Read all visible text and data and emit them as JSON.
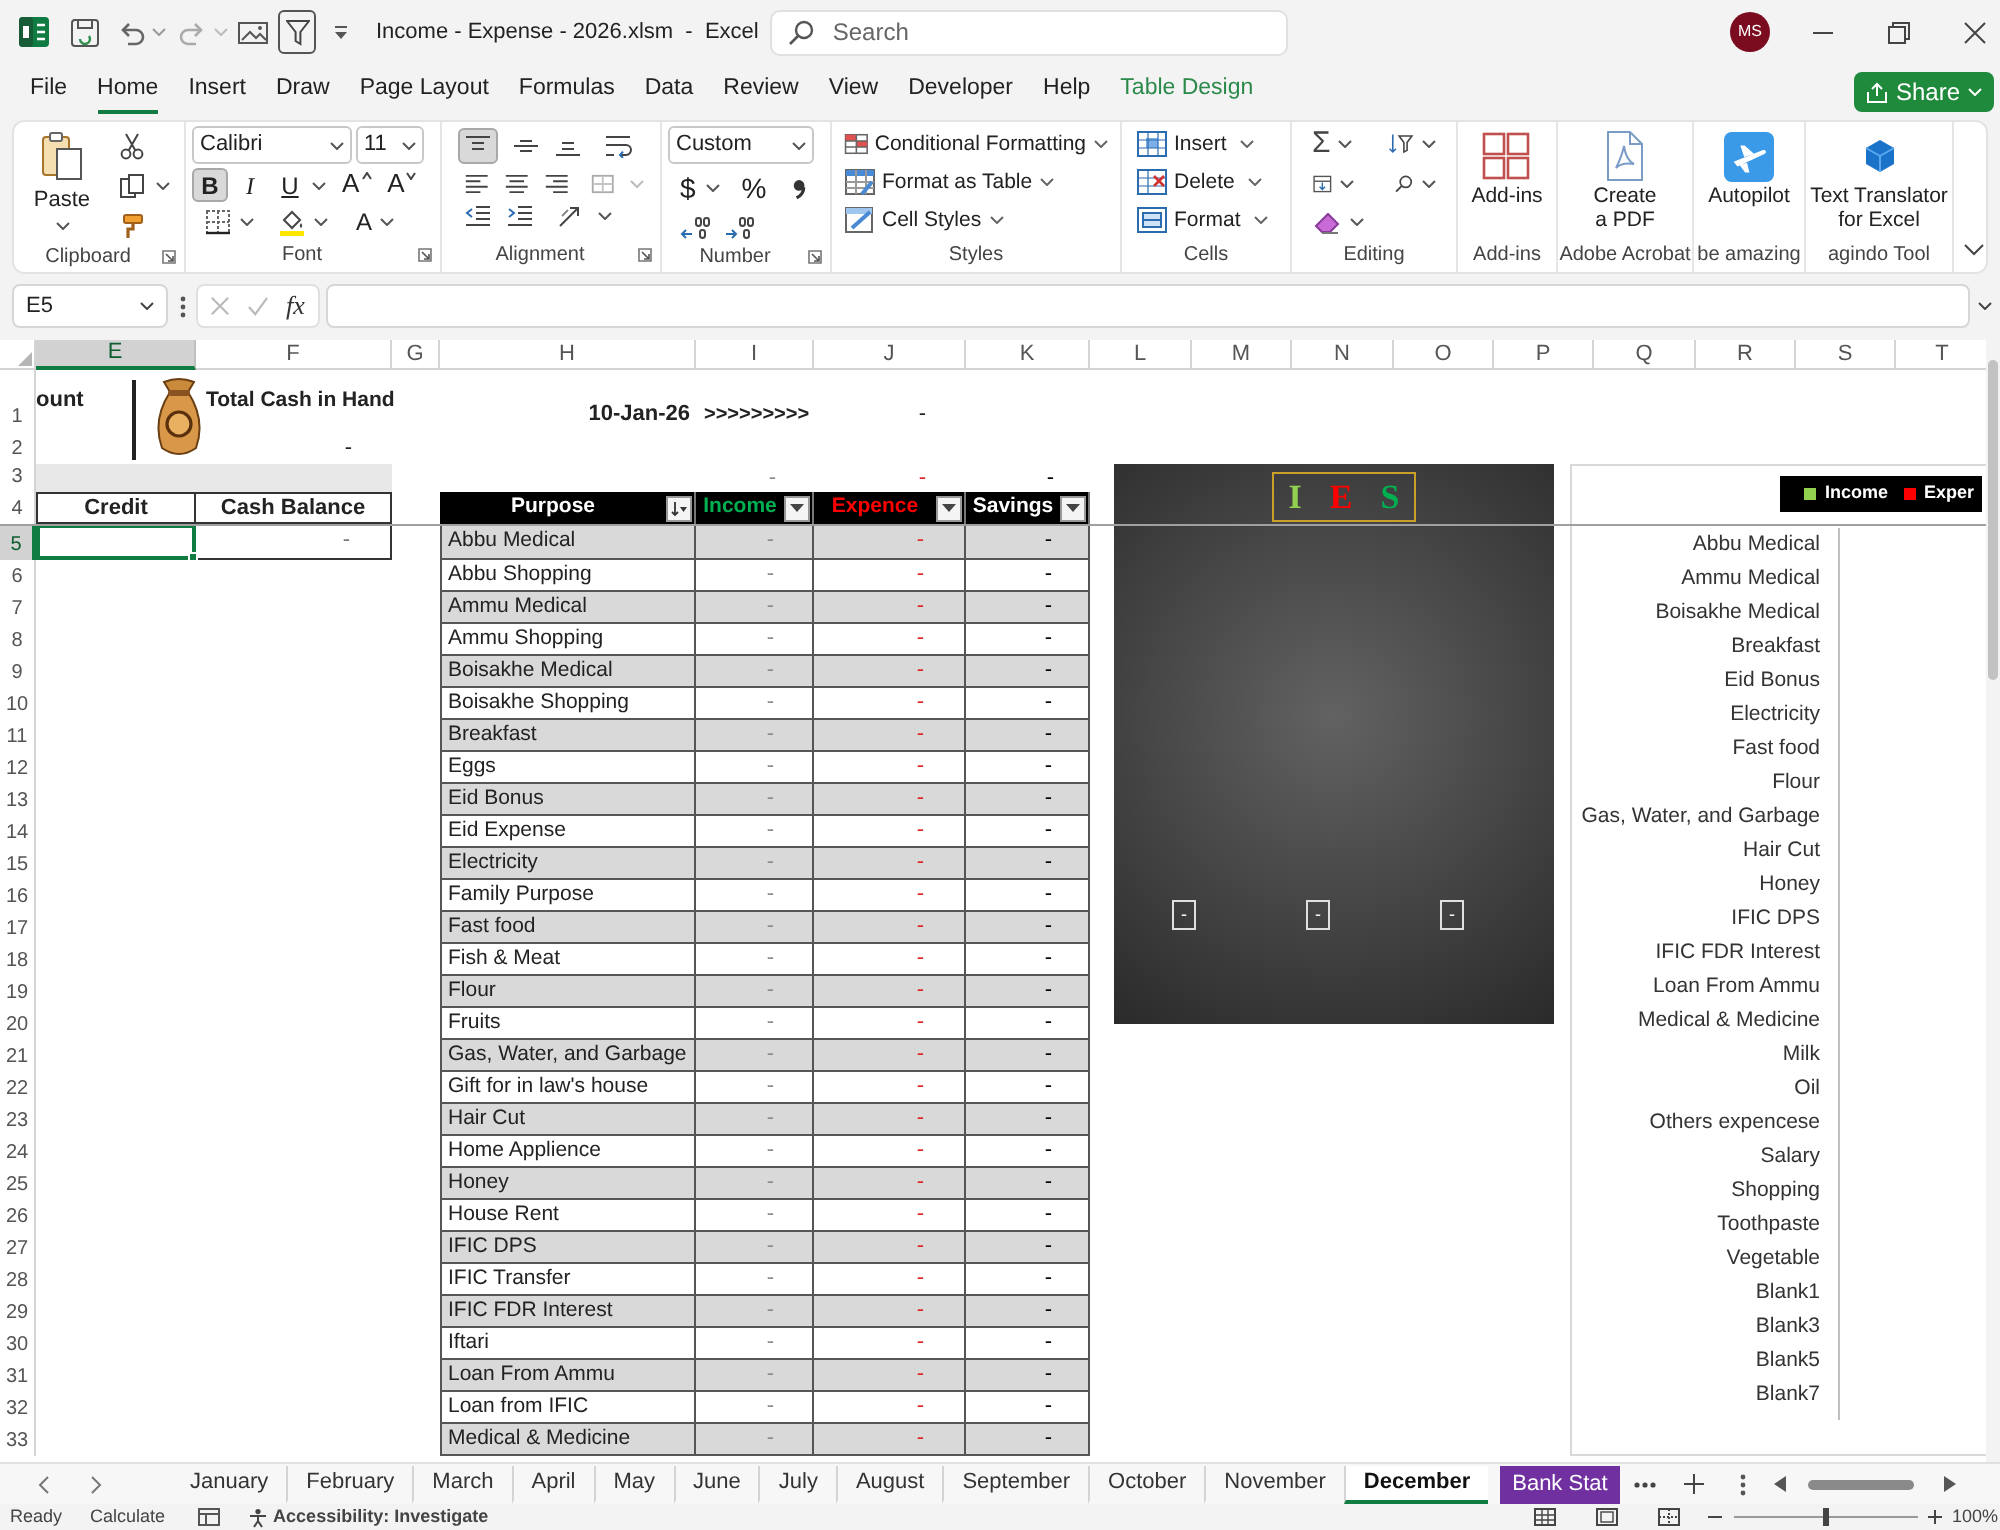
{
  "title_bar": {
    "title": "Income - Expense - 2026.xlsm  -  Excel",
    "search": {
      "placeholder": "Search"
    },
    "avatar": "MS"
  },
  "ribbon_tabs": [
    {
      "label": "File",
      "selected": false,
      "kind": "tab"
    },
    {
      "label": "Home",
      "selected": true,
      "kind": "tab"
    },
    {
      "label": "Insert",
      "selected": false,
      "kind": "tab"
    },
    {
      "label": "Draw",
      "selected": false,
      "kind": "tab"
    },
    {
      "label": "Page Layout",
      "selected": false,
      "kind": "tab"
    },
    {
      "label": "Formulas",
      "selected": false,
      "kind": "tab"
    },
    {
      "label": "Data",
      "selected": false,
      "kind": "tab"
    },
    {
      "label": "Review",
      "selected": false,
      "kind": "tab"
    },
    {
      "label": "View",
      "selected": false,
      "kind": "tab"
    },
    {
      "label": "Developer",
      "selected": false,
      "kind": "tab"
    },
    {
      "label": "Help",
      "selected": false,
      "kind": "tab"
    },
    {
      "label": "Table Design",
      "selected": false,
      "kind": "contextual"
    }
  ],
  "share": "Share",
  "ribbon_groups": [
    {
      "kind": "clipboard",
      "label": "Clipboard",
      "paste": "Paste"
    },
    {
      "kind": "font",
      "label": "Font",
      "font_name": "Calibri",
      "font_size": "11",
      "styles": [
        {
          "label": "B",
          "selected": true
        },
        {
          "label": "I",
          "selected": false
        },
        {
          "label": "U",
          "selected": false
        }
      ],
      "size_steps": [
        "A",
        "A"
      ],
      "font_color": "A"
    },
    {
      "kind": "alignment",
      "label": "Alignment",
      "top_align": true
    },
    {
      "kind": "number",
      "label": "Number",
      "format": "Custom",
      "currency": "$",
      "percent": "%"
    },
    {
      "kind": "styles",
      "label": "Styles",
      "commands": [
        "Conditional Formatting",
        "Format as Table",
        "Cell Styles"
      ]
    },
    {
      "kind": "cells",
      "label": "Cells",
      "commands": [
        "Insert",
        "Delete",
        "Format"
      ]
    },
    {
      "kind": "editing",
      "label": "Editing",
      "sum": "Σ"
    },
    {
      "kind": "addins",
      "label": "Add-ins",
      "button": [
        "Add-ins"
      ]
    },
    {
      "kind": "acrobat",
      "label": "Adobe Acrobat",
      "button": [
        "Create",
        "a PDF"
      ]
    },
    {
      "kind": "autopilot",
      "label": "be amazing",
      "button": [
        "Autopilot"
      ]
    },
    {
      "kind": "translator",
      "label": "agindo Tool",
      "button": [
        "Text Translator",
        "for Excel"
      ]
    }
  ],
  "formula_bar": {
    "name_box": "E5",
    "function_label": "fx"
  },
  "columns": [
    {
      "label": "E",
      "selected": true
    },
    {
      "label": "F",
      "selected": false
    },
    {
      "label": "G",
      "selected": false
    },
    {
      "label": "H",
      "selected": false
    },
    {
      "label": "I",
      "selected": false
    },
    {
      "label": "J",
      "selected": false
    },
    {
      "label": "K",
      "selected": false
    },
    {
      "label": "L",
      "selected": false
    },
    {
      "label": "M",
      "selected": false
    },
    {
      "label": "N",
      "selected": false
    },
    {
      "label": "O",
      "selected": false
    },
    {
      "label": "P",
      "selected": false
    },
    {
      "label": "Q",
      "selected": false
    },
    {
      "label": "R",
      "selected": false
    },
    {
      "label": "S",
      "selected": false
    },
    {
      "label": "T",
      "selected": false
    }
  ],
  "rows": [
    {
      "label": "1",
      "selected": false
    },
    {
      "label": "2",
      "selected": false
    },
    {
      "label": "3",
      "selected": false
    },
    {
      "label": "4",
      "selected": false
    },
    {
      "label": "5",
      "selected": true
    },
    {
      "label": "6",
      "selected": false
    },
    {
      "label": "7",
      "selected": false
    },
    {
      "label": "8",
      "selected": false
    },
    {
      "label": "9",
      "selected": false
    },
    {
      "label": "10",
      "selected": false
    },
    {
      "label": "11",
      "selected": false
    },
    {
      "label": "12",
      "selected": false
    },
    {
      "label": "13",
      "selected": false
    },
    {
      "label": "14",
      "selected": false
    },
    {
      "label": "15",
      "selected": false
    },
    {
      "label": "16",
      "selected": false
    },
    {
      "label": "17",
      "selected": false
    },
    {
      "label": "18",
      "selected": false
    },
    {
      "label": "19",
      "selected": false
    },
    {
      "label": "20",
      "selected": false
    },
    {
      "label": "21",
      "selected": false
    },
    {
      "label": "22",
      "selected": false
    },
    {
      "label": "23",
      "selected": false
    },
    {
      "label": "24",
      "selected": false
    },
    {
      "label": "25",
      "selected": false
    },
    {
      "label": "26",
      "selected": false
    },
    {
      "label": "27",
      "selected": false
    },
    {
      "label": "28",
      "selected": false
    },
    {
      "label": "29",
      "selected": false
    },
    {
      "label": "30",
      "selected": false
    },
    {
      "label": "31",
      "selected": false
    },
    {
      "label": "32",
      "selected": false
    },
    {
      "label": "33",
      "selected": false
    }
  ],
  "summary": {
    "amount_label": "ount",
    "cash_title": "Total Cash in Hand",
    "cash_value": "-",
    "date": "10-Jan-26",
    "arrows": ">>>>>>>>>",
    "date_value": "-",
    "totals": [
      "-",
      "-",
      "-"
    ]
  },
  "ledger": {
    "headers": [
      "Credit",
      "Cash Balance"
    ],
    "credit_selected": true,
    "balance": "-"
  },
  "table": {
    "columns": [
      {
        "label": "Purpose",
        "kind": "purpose",
        "sorted": true
      },
      {
        "label": "Income",
        "kind": "income",
        "sorted": false
      },
      {
        "label": "Expence",
        "kind": "expense",
        "sorted": false
      },
      {
        "label": "Savings",
        "kind": "savings",
        "sorted": false
      }
    ],
    "rows": [
      {
        "purpose": "Abbu Medical",
        "values": [
          "-",
          "-",
          "-"
        ]
      },
      {
        "purpose": "Abbu Shopping",
        "values": [
          "-",
          "-",
          "-"
        ]
      },
      {
        "purpose": "Ammu Medical",
        "values": [
          "-",
          "-",
          "-"
        ]
      },
      {
        "purpose": "Ammu Shopping",
        "values": [
          "-",
          "-",
          "-"
        ]
      },
      {
        "purpose": "Boisakhe Medical",
        "values": [
          "-",
          "-",
          "-"
        ]
      },
      {
        "purpose": "Boisakhe Shopping",
        "values": [
          "-",
          "-",
          "-"
        ]
      },
      {
        "purpose": "Breakfast",
        "values": [
          "-",
          "-",
          "-"
        ]
      },
      {
        "purpose": "Eggs",
        "values": [
          "-",
          "-",
          "-"
        ]
      },
      {
        "purpose": "Eid Bonus",
        "values": [
          "-",
          "-",
          "-"
        ]
      },
      {
        "purpose": "Eid Expense",
        "values": [
          "-",
          "-",
          "-"
        ]
      },
      {
        "purpose": "Electricity",
        "values": [
          "-",
          "-",
          "-"
        ]
      },
      {
        "purpose": "Family Purpose",
        "values": [
          "-",
          "-",
          "-"
        ]
      },
      {
        "purpose": "Fast food",
        "values": [
          "-",
          "-",
          "-"
        ]
      },
      {
        "purpose": "Fish & Meat",
        "values": [
          "-",
          "-",
          "-"
        ]
      },
      {
        "purpose": "Flour",
        "values": [
          "-",
          "-",
          "-"
        ]
      },
      {
        "purpose": "Fruits",
        "values": [
          "-",
          "-",
          "-"
        ]
      },
      {
        "purpose": "Gas, Water, and Garbage",
        "values": [
          "-",
          "-",
          "-"
        ]
      },
      {
        "purpose": "Gift for in law's house",
        "values": [
          "-",
          "-",
          "-"
        ]
      },
      {
        "purpose": "Hair Cut",
        "values": [
          "-",
          "-",
          "-"
        ]
      },
      {
        "purpose": "Home Applience",
        "values": [
          "-",
          "-",
          "-"
        ]
      },
      {
        "purpose": "Honey",
        "values": [
          "-",
          "-",
          "-"
        ]
      },
      {
        "purpose": "House Rent",
        "values": [
          "-",
          "-",
          "-"
        ]
      },
      {
        "purpose": "IFIC DPS",
        "values": [
          "-",
          "-",
          "-"
        ]
      },
      {
        "purpose": "IFIC Transfer",
        "values": [
          "-",
          "-",
          "-"
        ]
      },
      {
        "purpose": "IFIC FDR Interest",
        "values": [
          "-",
          "-",
          "-"
        ]
      },
      {
        "purpose": "Iftari",
        "values": [
          "-",
          "-",
          "-"
        ]
      },
      {
        "purpose": "Loan From Ammu",
        "values": [
          "-",
          "-",
          "-"
        ]
      },
      {
        "purpose": "Loan from IFIC",
        "values": [
          "-",
          "-",
          "-"
        ]
      },
      {
        "purpose": "Medical & Medicine",
        "values": [
          "-",
          "-",
          "-"
        ]
      }
    ]
  },
  "ies_chart": {
    "title_letters": [
      {
        "text": "I",
        "color": "#92d050"
      },
      {
        "text": "E",
        "color": "#ff0000"
      },
      {
        "text": "S",
        "color": "#00b050"
      }
    ],
    "bar_labels": [
      "-",
      "-",
      "-"
    ]
  },
  "category_chart": {
    "legend": [
      {
        "label": "Income",
        "color": "#92d050"
      },
      {
        "label": "Exper",
        "color": "#ff0000"
      }
    ],
    "categories": [
      "Abbu Medical",
      "Ammu Medical",
      "Boisakhe Medical",
      "Breakfast",
      "Eid Bonus",
      "Electricity",
      "Fast food",
      "Flour",
      "Gas, Water, and Garbage",
      "Hair Cut",
      "Honey",
      "IFIC DPS",
      "IFIC FDR Interest",
      "Loan From Ammu",
      "Medical & Medicine",
      "Milk",
      "Oil",
      "Others expencese",
      "Salary",
      "Shopping",
      "Toothpaste",
      "Vegetable",
      "Blank1",
      "Blank3",
      "Blank5",
      "Blank7"
    ]
  },
  "sheet_tabs": [
    {
      "label": "January",
      "selected": false
    },
    {
      "label": "February",
      "selected": false
    },
    {
      "label": "March",
      "selected": false
    },
    {
      "label": "April",
      "selected": false
    },
    {
      "label": "May",
      "selected": false
    },
    {
      "label": "June",
      "selected": false
    },
    {
      "label": "July",
      "selected": false
    },
    {
      "label": "August",
      "selected": false
    },
    {
      "label": "September",
      "selected": false
    },
    {
      "label": "October",
      "selected": false
    },
    {
      "label": "November",
      "selected": false
    },
    {
      "label": "December",
      "selected": true
    },
    {
      "label": "Bank Stat",
      "selected": false,
      "color": "#7030a0"
    }
  ],
  "status_bar": {
    "ready": "Ready",
    "calculate": "Calculate",
    "accessibility": "Accessibility: Investigate",
    "zoom_slider": {
      "level": 0.5
    },
    "zoom": "100%"
  }
}
